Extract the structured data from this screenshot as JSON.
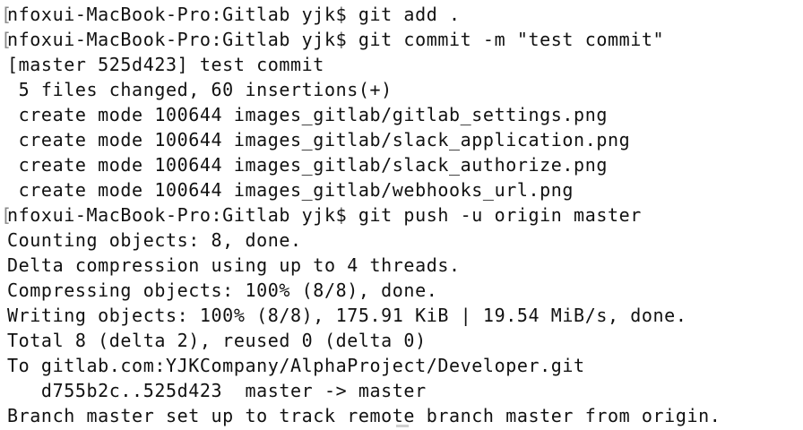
{
  "terminal": {
    "prompt_mark": "[",
    "lines": [
      {
        "text": "nfoxui-MacBook-Pro:Gitlab yjk$ git add .",
        "prompt": true
      },
      {
        "text": "nfoxui-MacBook-Pro:Gitlab yjk$ git commit -m \"test commit\"",
        "prompt": true
      },
      {
        "text": "[master 525d423] test commit",
        "prompt": false
      },
      {
        "text": " 5 files changed, 60 insertions(+)",
        "prompt": false
      },
      {
        "text": " create mode 100644 images_gitlab/gitlab_settings.png",
        "prompt": false
      },
      {
        "text": " create mode 100644 images_gitlab/slack_application.png",
        "prompt": false
      },
      {
        "text": " create mode 100644 images_gitlab/slack_authorize.png",
        "prompt": false
      },
      {
        "text": " create mode 100644 images_gitlab/webhooks_url.png",
        "prompt": false
      },
      {
        "text": "nfoxui-MacBook-Pro:Gitlab yjk$ git push -u origin master",
        "prompt": true
      },
      {
        "text": "Counting objects: 8, done.",
        "prompt": false
      },
      {
        "text": "Delta compression using up to 4 threads.",
        "prompt": false
      },
      {
        "text": "Compressing objects: 100% (8/8), done.",
        "prompt": false
      },
      {
        "text": "Writing objects: 100% (8/8), 175.91 KiB | 19.54 MiB/s, done.",
        "prompt": false
      },
      {
        "text": "Total 8 (delta 2), reused 0 (delta 0)",
        "prompt": false
      },
      {
        "text": "To gitlab.com:YJKCompany/AlphaProject/Developer.git",
        "prompt": false
      },
      {
        "text": "   d755b2c..525d423  master -> master",
        "prompt": false
      },
      {
        "text": "Branch master set up to track remote branch master from origin.",
        "prompt": false
      }
    ]
  }
}
